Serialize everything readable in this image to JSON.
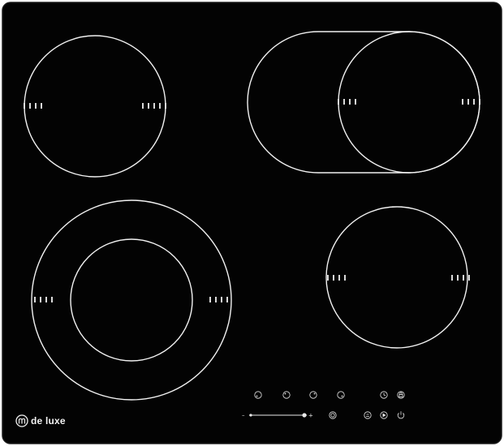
{
  "brand": {
    "name": "de luxe",
    "logo_letter": "m"
  },
  "colors": {
    "glass": "#030303",
    "glass_edge": "#1a1a1a",
    "marking": "#f2f2f2"
  },
  "zones": [
    {
      "name": "zone-front-left-dual",
      "shape": "dual-circle"
    },
    {
      "name": "zone-rear-left",
      "shape": "circle"
    },
    {
      "name": "zone-rear-right-extended",
      "shape": "oval-extension"
    },
    {
      "name": "zone-front-right",
      "shape": "circle"
    }
  ],
  "controls": {
    "zone_buttons": [
      "zone-1-select",
      "zone-2-select",
      "zone-3-select",
      "zone-4-select"
    ],
    "timer_icon": "clock-icon",
    "lock_icon": "lock-icon",
    "slider": {
      "minus_label": "–",
      "plus_label": "+"
    },
    "function_icons": [
      "dual-zone-icon",
      "keep-warm-icon",
      "boost-icon",
      "power-icon"
    ]
  }
}
